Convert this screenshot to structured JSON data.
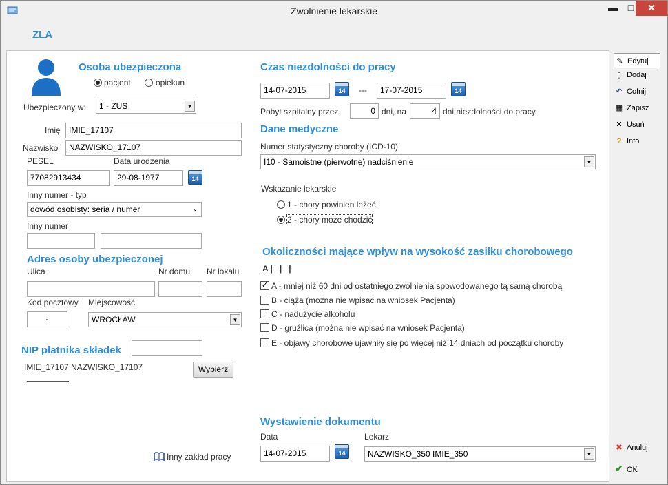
{
  "window": {
    "title": "Zwolnienie lekarskie",
    "min_glyph": "▬",
    "max_glyph": "□",
    "close_glyph": "✕"
  },
  "header": {
    "title": "ZLA"
  },
  "insured": {
    "section_title": "Osoba ubezpieczona",
    "role_patient": "pacjent",
    "role_guardian": "opiekun",
    "insured_in_label": "Ubezpieczony w:",
    "insured_in_value": "1 - ZUS",
    "first_name_label": "Imię",
    "first_name_value": "IMIE_17107",
    "last_name_label": "Nazwisko",
    "last_name_value": "NAZWISKO_17107",
    "pesel_label": "PESEL",
    "pesel_value": "77082913434",
    "birth_label": "Data urodzenia",
    "birth_value": "29-08-1977",
    "other_type_label": "Inny numer - typ",
    "other_type_value": "dowód osobisty: seria / numer",
    "other_number_label": "Inny numer"
  },
  "address": {
    "section_title": "Adres osoby ubezpieczonej",
    "street_label": "Ulica",
    "house_label": "Nr domu",
    "flat_label": "Nr lokalu",
    "postal_label": "Kod pocztowy",
    "postal_value": "-",
    "city_label": "Miejscowość",
    "city_value": "WROCŁAW"
  },
  "payer": {
    "section_title": "NIP płatnika składek",
    "name": "IMIE_17107 NAZWISKO_17107",
    "choose_button": "Wybierz",
    "other_workplace": "Inny zakład pracy"
  },
  "incapacity": {
    "section_title": "Czas niezdolności do pracy",
    "from": "14-07-2015",
    "separator": "---",
    "to": "17-07-2015",
    "hospital_label": "Pobyt szpitalny przez",
    "hospital_days": "0",
    "days_on_label": "dni, na",
    "incapacity_days": "4",
    "days_suffix": "dni niezdolności do pracy"
  },
  "medical": {
    "section_title": "Dane medyczne",
    "icd_label": "Numer statystyczny choroby (ICD-10)",
    "icd_value": "I10 - Samoistne (pierwotne) nadciśnienie",
    "indication_label": "Wskazanie lekarskie",
    "option1": "1 - chory powinien leżeć",
    "option2": "2 - chory może chodzić"
  },
  "circumstances": {
    "section_title": "Okoliczności mające wpływ na wysokość zasiłku chorobowego",
    "codes": "A |   |   |",
    "items": [
      {
        "label": "A - mniej niż 60 dni od ostatniego zwolnienia spowodowanego tą samą chorobą",
        "checked": true
      },
      {
        "label": "B - ciąża (można nie wpisać na wniosek Pacjenta)",
        "checked": false
      },
      {
        "label": "C - nadużycie alkoholu",
        "checked": false
      },
      {
        "label": "D - gruźlica (można nie wpisać na wniosek Pacjenta)",
        "checked": false
      },
      {
        "label": "E - objawy chorobowe ujawniły się po więcej niż 14 dniach od początku choroby",
        "checked": false
      }
    ]
  },
  "issuance": {
    "section_title": "Wystawienie dokumentu",
    "date_label": "Data",
    "date_value": "14-07-2015",
    "doctor_label": "Lekarz",
    "doctor_value": "NAZWISKO_350 IMIE_350"
  },
  "calendar_icon_text": "14",
  "sidebar": {
    "edit": "Edytuj",
    "add": "Dodaj",
    "undo": "Cofnij",
    "save": "Zapisz",
    "delete": "Usuń",
    "info": "Info",
    "cancel": "Anuluj",
    "ok": "OK"
  },
  "colors": {
    "section": "#2e8fd8",
    "close": "#c7453a"
  }
}
